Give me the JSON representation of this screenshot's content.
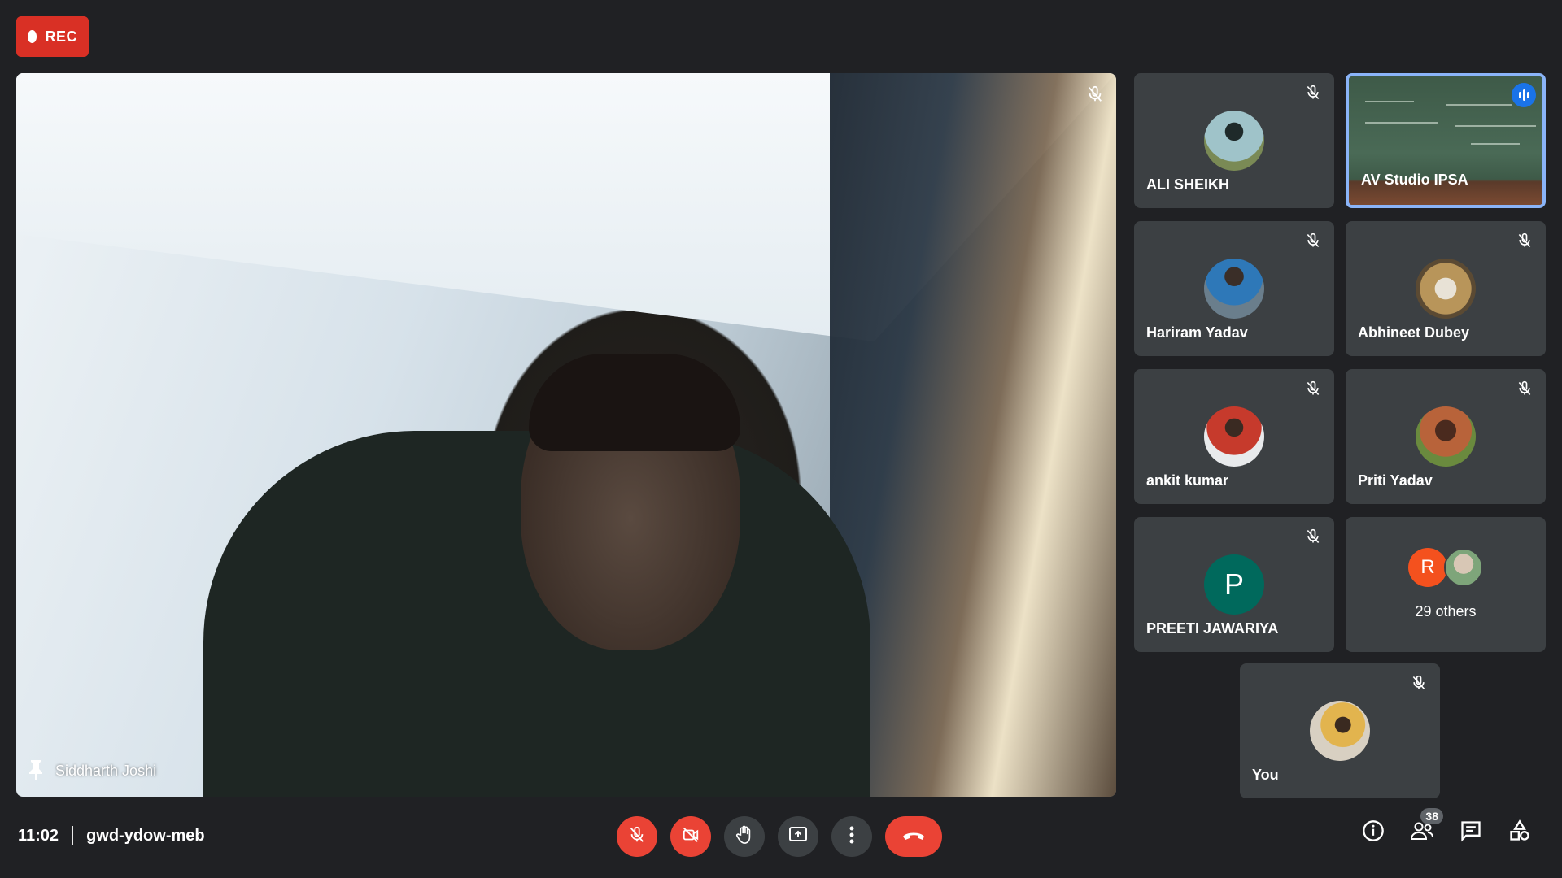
{
  "recording": {
    "label": "REC"
  },
  "main": {
    "speaker_name": "Siddharth Joshi"
  },
  "tiles": [
    {
      "name": "ALI SHEIKH",
      "muted": true
    },
    {
      "name": "AV Studio IPSA",
      "speaking": true
    },
    {
      "name": "Hariram Yadav",
      "muted": true
    },
    {
      "name": "Abhineet Dubey",
      "muted": true
    },
    {
      "name": "ankit kumar",
      "muted": true
    },
    {
      "name": "Priti Yadav",
      "muted": true
    },
    {
      "name": "PREETI JAWARIYA",
      "muted": true,
      "initial": "P"
    },
    {
      "others_initial": "R",
      "others_label": "29 others"
    },
    {
      "name": "You",
      "muted": true
    }
  ],
  "meeting": {
    "time": "11:02",
    "code": "gwd-ydow-meb"
  },
  "toolbar": {
    "icons": [
      "mic-off-icon",
      "camera-off-icon",
      "raise-hand-icon",
      "present-icon",
      "more-icon",
      "end-call-icon"
    ]
  },
  "side_icons": {
    "people_count": "38"
  },
  "colors": {
    "background": "#202124",
    "tile": "#3c4043",
    "danger": "#ea4335",
    "speaking": "#8ab4f8"
  }
}
